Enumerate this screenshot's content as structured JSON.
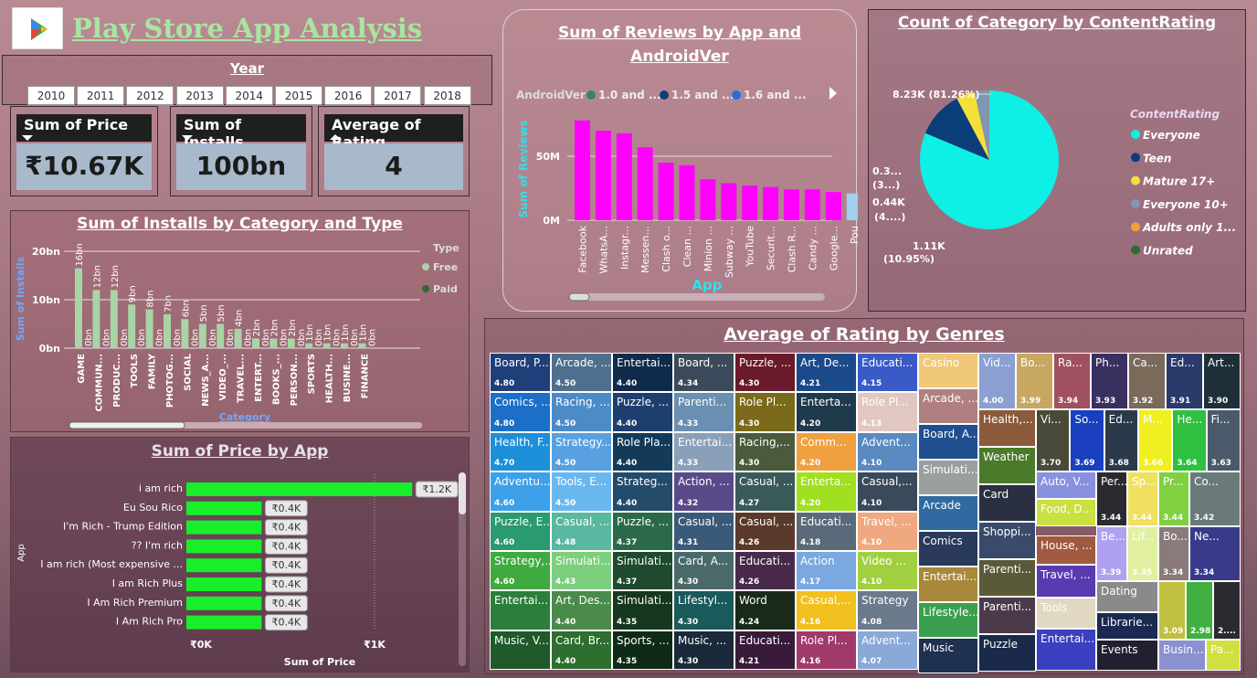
{
  "header": {
    "title": "Play Store App Analysis"
  },
  "year_slicer": {
    "label": "Year",
    "years": [
      "2010",
      "2011",
      "2012",
      "2013",
      "2014",
      "2015",
      "2016",
      "2017",
      "2018"
    ]
  },
  "kpis": [
    {
      "label": "Sum of Price",
      "value": "₹10.67K"
    },
    {
      "label": "Sum of Installs",
      "value": "100bn"
    },
    {
      "label": "Average of Rating",
      "value": "4"
    }
  ],
  "reviews_chart": {
    "title": "Sum of Reviews by App and AndroidVer",
    "legend_label": "AndroidVer",
    "legend": [
      "1.0 and ...",
      "1.5 and ...",
      "1.6 and ..."
    ],
    "ylabel": "Sum of Reviews",
    "xlabel": "App",
    "ticks": [
      "50M",
      "0M"
    ]
  },
  "installs_chart": {
    "title": "Sum of Installs by Category and Type",
    "ylabel": "Sum of Installs",
    "xlabel": "Category",
    "legend_label": "Type",
    "legend": [
      "Free",
      "Paid"
    ],
    "ticks": [
      "20bn",
      "10bn",
      "0bn"
    ]
  },
  "price_chart": {
    "title": "Sum of Price by App",
    "xlabel": "Sum of Price",
    "ylabel": "App",
    "ticks": [
      "₹0K",
      "₹1K"
    ]
  },
  "pie_chart": {
    "title": "Count of Category by ContentRating",
    "legend_label": "ContentRating",
    "legend": [
      "Everyone",
      "Teen",
      "Mature 17+",
      "Everyone 10+",
      "Adults only 1...",
      "Unrated"
    ],
    "labels": [
      "8.23K (81.26%)",
      "1.11K",
      "(10.95%)",
      "0.44K",
      "(4....)",
      "0.3...",
      "(3...)"
    ]
  },
  "treemap": {
    "title": "Average of Rating by Genres"
  },
  "chart_data": [
    {
      "type": "bar",
      "title": "Sum of Reviews by App and AndroidVer",
      "xlabel": "App",
      "ylabel": "Sum of Reviews",
      "categories": [
        "Facebook",
        "WhatsA...",
        "Instagr...",
        "Messen...",
        "Clash o...",
        "Clean ...",
        "Minion ...",
        "Subway ...",
        "YouTube",
        "Securit...",
        "Clash R...",
        "Candy ...",
        "Google...",
        "Pou"
      ],
      "values": [
        78,
        70,
        68,
        57,
        45,
        43,
        32,
        29,
        27,
        26,
        24,
        24,
        22,
        21
      ],
      "colors": [
        "#ff00ff",
        "#ff00ff",
        "#ff00ff",
        "#ff00ff",
        "#ff00ff",
        "#ff00ff",
        "#ff00ff",
        "#ff00ff",
        "#ff00ff",
        "#ff00ff",
        "#ff00ff",
        "#ff00ff",
        "#ff00ff",
        "#9fd0f0"
      ],
      "ylim": [
        0,
        90
      ]
    },
    {
      "type": "bar",
      "title": "Sum of Installs by Category and Type",
      "xlabel": "Category",
      "ylabel": "Sum of Installs",
      "categories": [
        "GAME",
        "COMMUN...",
        "PRODUC...",
        "TOOLS",
        "FAMILY",
        "PHOTOG...",
        "SOCIAL",
        "NEWS_A...",
        "VIDEO_...",
        "TRAVEL...",
        "ENTERT...",
        "BOOKS_...",
        "PERSON...",
        "SPORTS",
        "HEALTH...",
        "BUSINE...",
        "FINANCE"
      ],
      "series": [
        {
          "name": "Free",
          "values": [
            16.5,
            12,
            12,
            9,
            8,
            7,
            6,
            5,
            5,
            4,
            2,
            2,
            2,
            1,
            1,
            1,
            1
          ]
        },
        {
          "name": "Paid",
          "values": [
            0,
            0,
            0,
            0,
            0,
            0,
            0,
            0,
            0,
            0,
            0,
            0,
            0,
            0,
            0,
            0,
            0
          ]
        }
      ],
      "labels_free": [
        "16bn",
        "12bn",
        "12bn",
        "9bn",
        "8bn",
        "7bn",
        "6bn",
        "5bn",
        "5bn",
        "4bn",
        "2bn",
        "2bn",
        "2bn",
        "1bn",
        "1bn",
        "1bn",
        "1bn"
      ],
      "labels_paid": [
        "0bn",
        "0bn",
        "0bn",
        "0bn",
        "0bn",
        "0bn",
        "0bn",
        "0bn",
        "0bn",
        "0bn",
        "0bn",
        "0bn",
        "0bn",
        "0bn",
        "0bn",
        "0bn",
        "0bn"
      ],
      "ylim": [
        0,
        20
      ]
    },
    {
      "type": "bar",
      "title": "Sum of Price by App",
      "xlabel": "Sum of Price",
      "ylabel": "App",
      "categories": [
        "i am rich",
        "Eu Sou Rico",
        "I'm Rich - Trump Edition",
        "?? I'm rich",
        "I am rich (Most expensive ...",
        "I am Rich Plus",
        "I Am Rich Premium",
        "I Am Rich Pro"
      ],
      "values": [
        1.2,
        0.4,
        0.4,
        0.4,
        0.4,
        0.4,
        0.4,
        0.4
      ],
      "labels": [
        "₹1.2K",
        "₹0.4K",
        "₹0.4K",
        "₹0.4K",
        "₹0.4K",
        "₹0.4K",
        "₹0.4K",
        "₹0.4K"
      ],
      "xlim": [
        0,
        1.4
      ]
    },
    {
      "type": "pie",
      "title": "Count of Category by ContentRating",
      "categories": [
        "Everyone",
        "Teen",
        "Mature 17+",
        "Everyone 10+",
        "Adults only 1...",
        "Unrated"
      ],
      "values": [
        81.26,
        10.95,
        4.3,
        3.4,
        0.03,
        0.01
      ],
      "colors": [
        "#0ef0e6",
        "#0b3d7a",
        "#f5e03a",
        "#7f97b0",
        "#f0a040",
        "#2e6b2e"
      ]
    },
    {
      "type": "table",
      "title": "Average of Rating by Genres"
    }
  ],
  "treemap_cells": [
    {
      "n": "Board, P...",
      "r": "4.80",
      "c": "#1e3f7a"
    },
    {
      "n": "Comics, ...",
      "r": "4.80",
      "c": "#1b6fc6"
    },
    {
      "n": "Health, F...",
      "r": "4.70",
      "c": "#1d8fd8"
    },
    {
      "n": "Adventu...",
      "r": "4.60",
      "c": "#3da0e8"
    },
    {
      "n": "Puzzle, E...",
      "r": "4.60",
      "c": "#2a9a70"
    },
    {
      "n": "Strategy,...",
      "r": "4.60",
      "c": "#3faa3f"
    },
    {
      "n": "Entertai...",
      "r": "",
      "c": "#2b7f3a"
    },
    {
      "n": "Music, V...",
      "r": "",
      "c": "#1f5a2a"
    },
    {
      "n": "Arcade, ...",
      "r": "4.50",
      "c": "#4e6f8e"
    },
    {
      "n": "Racing, ...",
      "r": "4.50",
      "c": "#4c8bc8"
    },
    {
      "n": "Strategy...",
      "r": "4.50",
      "c": "#58a0e0"
    },
    {
      "n": "Tools, E...",
      "r": "4.50",
      "c": "#6bb8f0"
    },
    {
      "n": "Casual, ...",
      "r": "4.48",
      "c": "#58b8a0"
    },
    {
      "n": "Simulati...",
      "r": "4.43",
      "c": "#7ccf7c"
    },
    {
      "n": "Art, Des...",
      "r": "4.40",
      "c": "#4a8a4a"
    },
    {
      "n": "Card, Br...",
      "r": "4.40",
      "c": "#2e6e2e"
    },
    {
      "n": "Entertai...",
      "r": "4.40",
      "c": "#0f2a4a"
    },
    {
      "n": "Puzzle, ...",
      "r": "4.40",
      "c": "#1e3f6e"
    },
    {
      "n": "Role Pla...",
      "r": "4.40",
      "c": "#143a5a"
    },
    {
      "n": "Strateg...",
      "r": "4.40",
      "c": "#234b6b"
    },
    {
      "n": "Puzzle, ...",
      "r": "4.37",
      "c": "#2a6a4a"
    },
    {
      "n": "Simulati...",
      "r": "4.37",
      "c": "#1e4a2e"
    },
    {
      "n": "Simulati...",
      "r": "4.35",
      "c": "#16381e"
    },
    {
      "n": "Sports, ...",
      "r": "4.35",
      "c": "#0f2a16"
    },
    {
      "n": "Board, ...",
      "r": "4.34",
      "c": "#3a4a5a"
    },
    {
      "n": "Parenti...",
      "r": "4.33",
      "c": "#6a8fb0"
    },
    {
      "n": "Entertai...",
      "r": "4.33",
      "c": "#8aa0b8"
    },
    {
      "n": "Action, ...",
      "r": "4.32",
      "c": "#5a4a8a"
    },
    {
      "n": "Casual, ...",
      "r": "4.31",
      "c": "#3a5a7a"
    },
    {
      "n": "Card, A...",
      "r": "4.30",
      "c": "#4a6a6a"
    },
    {
      "n": "Lifestyl...",
      "r": "4.30",
      "c": "#1a5a5a"
    },
    {
      "n": "Music, ...",
      "r": "4.30",
      "c": "#1a2a3a"
    },
    {
      "n": "Puzzle, ...",
      "r": "4.30",
      "c": "#6a1a2a"
    },
    {
      "n": "Role Pl...",
      "r": "4.30",
      "c": "#7a6a1a"
    },
    {
      "n": "Racing,...",
      "r": "4.30",
      "c": "#4a5a3a"
    },
    {
      "n": "Casual, ...",
      "r": "4.27",
      "c": "#3a5a5a"
    },
    {
      "n": "Casual, ...",
      "r": "4.26",
      "c": "#5a3a2a"
    },
    {
      "n": "Educati...",
      "r": "4.26",
      "c": "#4a2a4a"
    },
    {
      "n": "Word",
      "r": "4.24",
      "c": "#1a2a1a"
    },
    {
      "n": "Educati...",
      "r": "4.21",
      "c": "#3a1a3a"
    },
    {
      "n": "Art, De...",
      "r": "4.21",
      "c": "#1a4a8a"
    },
    {
      "n": "Enterta...",
      "r": "4.20",
      "c": "#1f3a4a"
    },
    {
      "n": "Comm...",
      "r": "4.20",
      "c": "#f0a040"
    },
    {
      "n": "Enterta...",
      "r": "4.20",
      "c": "#a0e020"
    },
    {
      "n": "Educati...",
      "r": "4.18",
      "c": "#5a6a7a"
    },
    {
      "n": "Action",
      "r": "4.17",
      "c": "#7aa8e0"
    },
    {
      "n": "Casual,...",
      "r": "4.16",
      "c": "#f0c020"
    },
    {
      "n": "Role Pl...",
      "r": "4.16",
      "c": "#a03a6a"
    },
    {
      "n": "Educati...",
      "r": "4.15",
      "c": "#3a5ac8"
    },
    {
      "n": "Role Pl...",
      "r": "4.13",
      "c": "#e0c8c0"
    },
    {
      "n": "Advent...",
      "r": "4.10",
      "c": "#5a8ac0"
    },
    {
      "n": "Casual,...",
      "r": "4.10",
      "c": "#3a4a5a"
    },
    {
      "n": "Travel, ...",
      "r": "4.10",
      "c": "#f0a880"
    },
    {
      "n": "Video ...",
      "r": "4.10",
      "c": "#a0d040"
    },
    {
      "n": "Strategy",
      "r": "4.08",
      "c": "#6a7a8a"
    },
    {
      "n": "Advent...",
      "r": "4.07",
      "c": "#8aa8d8"
    }
  ],
  "treemap_right": [
    {
      "n": "Casino",
      "c": "#f0c878"
    },
    {
      "n": "Arcade, ...",
      "c": "#b08080"
    },
    {
      "n": "Board, A...",
      "c": "#1f4f8f"
    },
    {
      "n": "Simulati...",
      "c": "#9aa0a0"
    },
    {
      "n": "Arcade",
      "c": "#2f6aa0"
    },
    {
      "n": "Comics",
      "c": "#2a3a5a"
    },
    {
      "n": "Entertai...",
      "c": "#a8883a"
    },
    {
      "n": "Lifestyle...",
      "c": "#3aa050"
    },
    {
      "n": "Music",
      "c": "#1f3050"
    }
  ],
  "treemap_top": [
    {
      "n": "Vid...",
      "r": "4.00",
      "c": "#8aa0d0"
    },
    {
      "n": "Bo...",
      "r": "3.99",
      "c": "#c8a860"
    },
    {
      "n": "Ra...",
      "r": "3.94",
      "c": "#a05060"
    },
    {
      "n": "Ph...",
      "r": "3.93",
      "c": "#3a3060"
    },
    {
      "n": "Ca...",
      "r": "3.92",
      "c": "#7a6a5a"
    },
    {
      "n": "Ed...",
      "r": "3.91",
      "c": "#2a3a6a"
    },
    {
      "n": "Art...",
      "r": "3.90",
      "c": "#1f2f3a"
    }
  ],
  "treemap_mid": [
    {
      "n": "Health,...",
      "c": "#8a5a3a"
    },
    {
      "n": "Weather",
      "c": "#4a7a2a"
    },
    {
      "n": "Card",
      "c": "#2a3040"
    },
    {
      "n": "Shoppi...",
      "c": "#3a4a6a"
    },
    {
      "n": "Parenti...",
      "c": "#5a5a3a"
    },
    {
      "n": "Parenti...",
      "c": "#4a3a4a"
    },
    {
      "n": "Puzzle",
      "c": "#1a2a4a"
    }
  ],
  "treemap_row2": [
    {
      "n": "Vi...",
      "r": "3.70",
      "c": "#4a4a3a"
    },
    {
      "n": "So...",
      "r": "3.69",
      "c": "#1a40c0"
    },
    {
      "n": "Ed...",
      "r": "3.68",
      "c": "#2a3a4a"
    },
    {
      "n": "M...",
      "r": "3.66",
      "c": "#f0f020"
    },
    {
      "n": "He...",
      "r": "3.64",
      "c": "#30c040"
    },
    {
      "n": "Fi...",
      "r": "3.63",
      "c": "#4a5a6a"
    }
  ],
  "treemap_row3": [
    {
      "n": "Auto, V...",
      "r": "",
      "c": "#8a90e0"
    },
    {
      "n": "Per...",
      "r": "3.44",
      "c": "#2a2a30"
    },
    {
      "n": "Sp...",
      "r": "3.44",
      "c": "#f0e060"
    },
    {
      "n": "Pr...",
      "r": "3.44",
      "c": "#80d040"
    },
    {
      "n": "Co...",
      "r": "3.42",
      "c": "#6a7a7a"
    },
    {
      "n": "Food, D...",
      "r": "",
      "c": "#c8e040"
    },
    {
      "n": "Be...",
      "r": "3.39",
      "c": "#b0a0f0"
    },
    {
      "n": "Lif...",
      "r": "3.35",
      "c": "#e0f0a0"
    },
    {
      "n": "Bo...",
      "r": "3.34",
      "c": "#8a7a7a"
    },
    {
      "n": "Ne...",
      "r": "3.34",
      "c": "#3a3a8a"
    },
    {
      "n": "House, ...",
      "r": "",
      "c": "#a05a40"
    },
    {
      "n": "Travel, ...",
      "r": "",
      "c": "#5a3ab0"
    },
    {
      "n": "Dating",
      "r": "",
      "c": "#8a8a8a"
    },
    {
      "n": "Tools",
      "r": "",
      "c": "#e0d8c0"
    },
    {
      "n": "Librarie...",
      "r": "",
      "c": "#1a2a50"
    },
    {
      "n": "",
      "r": "3.09",
      "c": "#c0c040"
    },
    {
      "n": "",
      "r": "2.98",
      "c": "#40b040"
    },
    {
      "n": "",
      "r": "2....",
      "c": "#2a2a30"
    },
    {
      "n": "Entertai...",
      "r": "",
      "c": "#3a40c0"
    },
    {
      "n": "Events",
      "r": "",
      "c": "#202030"
    },
    {
      "n": "Busin...",
      "r": "",
      "c": "#8a90d0"
    },
    {
      "n": "Pa...",
      "r": "",
      "c": "#d0e040"
    }
  ]
}
